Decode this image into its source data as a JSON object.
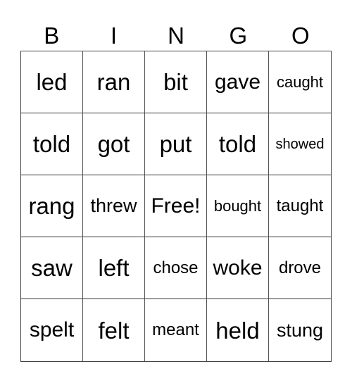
{
  "header": {
    "letters": [
      "B",
      "I",
      "N",
      "G",
      "O"
    ]
  },
  "board": {
    "rows": [
      [
        "led",
        "ran",
        "bit",
        "gave",
        "caught"
      ],
      [
        "told",
        "got",
        "put",
        "told",
        "showed"
      ],
      [
        "rang",
        "threw",
        "Free!",
        "bought",
        "taught"
      ],
      [
        "saw",
        "left",
        "chose",
        "woke",
        "drove"
      ],
      [
        "spelt",
        "felt",
        "meant",
        "held",
        "stung"
      ]
    ]
  }
}
